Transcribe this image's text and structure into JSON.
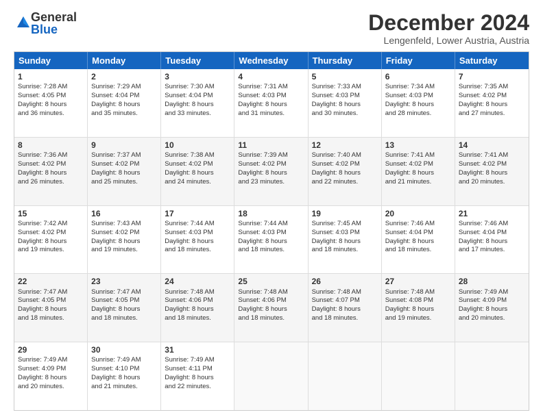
{
  "logo": {
    "general": "General",
    "blue": "Blue"
  },
  "header": {
    "month": "December 2024",
    "location": "Lengenfeld, Lower Austria, Austria"
  },
  "weekdays": [
    "Sunday",
    "Monday",
    "Tuesday",
    "Wednesday",
    "Thursday",
    "Friday",
    "Saturday"
  ],
  "weeks": [
    [
      {
        "day": "1",
        "lines": [
          "Sunrise: 7:28 AM",
          "Sunset: 4:05 PM",
          "Daylight: 8 hours",
          "and 36 minutes."
        ]
      },
      {
        "day": "2",
        "lines": [
          "Sunrise: 7:29 AM",
          "Sunset: 4:04 PM",
          "Daylight: 8 hours",
          "and 35 minutes."
        ]
      },
      {
        "day": "3",
        "lines": [
          "Sunrise: 7:30 AM",
          "Sunset: 4:04 PM",
          "Daylight: 8 hours",
          "and 33 minutes."
        ]
      },
      {
        "day": "4",
        "lines": [
          "Sunrise: 7:31 AM",
          "Sunset: 4:03 PM",
          "Daylight: 8 hours",
          "and 31 minutes."
        ]
      },
      {
        "day": "5",
        "lines": [
          "Sunrise: 7:33 AM",
          "Sunset: 4:03 PM",
          "Daylight: 8 hours",
          "and 30 minutes."
        ]
      },
      {
        "day": "6",
        "lines": [
          "Sunrise: 7:34 AM",
          "Sunset: 4:03 PM",
          "Daylight: 8 hours",
          "and 28 minutes."
        ]
      },
      {
        "day": "7",
        "lines": [
          "Sunrise: 7:35 AM",
          "Sunset: 4:02 PM",
          "Daylight: 8 hours",
          "and 27 minutes."
        ]
      }
    ],
    [
      {
        "day": "8",
        "lines": [
          "Sunrise: 7:36 AM",
          "Sunset: 4:02 PM",
          "Daylight: 8 hours",
          "and 26 minutes."
        ]
      },
      {
        "day": "9",
        "lines": [
          "Sunrise: 7:37 AM",
          "Sunset: 4:02 PM",
          "Daylight: 8 hours",
          "and 25 minutes."
        ]
      },
      {
        "day": "10",
        "lines": [
          "Sunrise: 7:38 AM",
          "Sunset: 4:02 PM",
          "Daylight: 8 hours",
          "and 24 minutes."
        ]
      },
      {
        "day": "11",
        "lines": [
          "Sunrise: 7:39 AM",
          "Sunset: 4:02 PM",
          "Daylight: 8 hours",
          "and 23 minutes."
        ]
      },
      {
        "day": "12",
        "lines": [
          "Sunrise: 7:40 AM",
          "Sunset: 4:02 PM",
          "Daylight: 8 hours",
          "and 22 minutes."
        ]
      },
      {
        "day": "13",
        "lines": [
          "Sunrise: 7:41 AM",
          "Sunset: 4:02 PM",
          "Daylight: 8 hours",
          "and 21 minutes."
        ]
      },
      {
        "day": "14",
        "lines": [
          "Sunrise: 7:41 AM",
          "Sunset: 4:02 PM",
          "Daylight: 8 hours",
          "and 20 minutes."
        ]
      }
    ],
    [
      {
        "day": "15",
        "lines": [
          "Sunrise: 7:42 AM",
          "Sunset: 4:02 PM",
          "Daylight: 8 hours",
          "and 19 minutes."
        ]
      },
      {
        "day": "16",
        "lines": [
          "Sunrise: 7:43 AM",
          "Sunset: 4:02 PM",
          "Daylight: 8 hours",
          "and 19 minutes."
        ]
      },
      {
        "day": "17",
        "lines": [
          "Sunrise: 7:44 AM",
          "Sunset: 4:03 PM",
          "Daylight: 8 hours",
          "and 18 minutes."
        ]
      },
      {
        "day": "18",
        "lines": [
          "Sunrise: 7:44 AM",
          "Sunset: 4:03 PM",
          "Daylight: 8 hours",
          "and 18 minutes."
        ]
      },
      {
        "day": "19",
        "lines": [
          "Sunrise: 7:45 AM",
          "Sunset: 4:03 PM",
          "Daylight: 8 hours",
          "and 18 minutes."
        ]
      },
      {
        "day": "20",
        "lines": [
          "Sunrise: 7:46 AM",
          "Sunset: 4:04 PM",
          "Daylight: 8 hours",
          "and 18 minutes."
        ]
      },
      {
        "day": "21",
        "lines": [
          "Sunrise: 7:46 AM",
          "Sunset: 4:04 PM",
          "Daylight: 8 hours",
          "and 17 minutes."
        ]
      }
    ],
    [
      {
        "day": "22",
        "lines": [
          "Sunrise: 7:47 AM",
          "Sunset: 4:05 PM",
          "Daylight: 8 hours",
          "and 18 minutes."
        ]
      },
      {
        "day": "23",
        "lines": [
          "Sunrise: 7:47 AM",
          "Sunset: 4:05 PM",
          "Daylight: 8 hours",
          "and 18 minutes."
        ]
      },
      {
        "day": "24",
        "lines": [
          "Sunrise: 7:48 AM",
          "Sunset: 4:06 PM",
          "Daylight: 8 hours",
          "and 18 minutes."
        ]
      },
      {
        "day": "25",
        "lines": [
          "Sunrise: 7:48 AM",
          "Sunset: 4:06 PM",
          "Daylight: 8 hours",
          "and 18 minutes."
        ]
      },
      {
        "day": "26",
        "lines": [
          "Sunrise: 7:48 AM",
          "Sunset: 4:07 PM",
          "Daylight: 8 hours",
          "and 18 minutes."
        ]
      },
      {
        "day": "27",
        "lines": [
          "Sunrise: 7:48 AM",
          "Sunset: 4:08 PM",
          "Daylight: 8 hours",
          "and 19 minutes."
        ]
      },
      {
        "day": "28",
        "lines": [
          "Sunrise: 7:49 AM",
          "Sunset: 4:09 PM",
          "Daylight: 8 hours",
          "and 20 minutes."
        ]
      }
    ],
    [
      {
        "day": "29",
        "lines": [
          "Sunrise: 7:49 AM",
          "Sunset: 4:09 PM",
          "Daylight: 8 hours",
          "and 20 minutes."
        ]
      },
      {
        "day": "30",
        "lines": [
          "Sunrise: 7:49 AM",
          "Sunset: 4:10 PM",
          "Daylight: 8 hours",
          "and 21 minutes."
        ]
      },
      {
        "day": "31",
        "lines": [
          "Sunrise: 7:49 AM",
          "Sunset: 4:11 PM",
          "Daylight: 8 hours",
          "and 22 minutes."
        ]
      },
      {
        "day": "",
        "lines": []
      },
      {
        "day": "",
        "lines": []
      },
      {
        "day": "",
        "lines": []
      },
      {
        "day": "",
        "lines": []
      }
    ]
  ]
}
